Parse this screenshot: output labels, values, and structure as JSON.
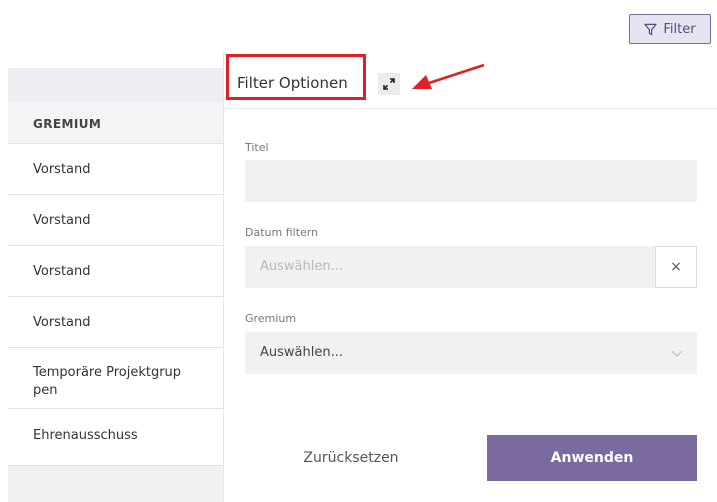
{
  "toolbar": {
    "filter_label": "Filter"
  },
  "table": {
    "header": "GREMIUM",
    "rows": [
      "Vorstand",
      "Vorstand",
      "Vorstand",
      "Vorstand",
      "Temporäre Projektgrup pen",
      "Ehrenausschuss"
    ]
  },
  "panel": {
    "title": "Filter Optionen",
    "fields": {
      "titel_label": "Titel",
      "datum_label": "Datum filtern",
      "datum_placeholder": "Auswählen...",
      "datum_clear": "×",
      "gremium_label": "Gremium",
      "gremium_value": "Auswählen..."
    },
    "buttons": {
      "reset": "Zurücksetzen",
      "apply": "Anwenden"
    }
  },
  "colors": {
    "accent": "#7a6a9f",
    "annotation": "#e01f26"
  }
}
